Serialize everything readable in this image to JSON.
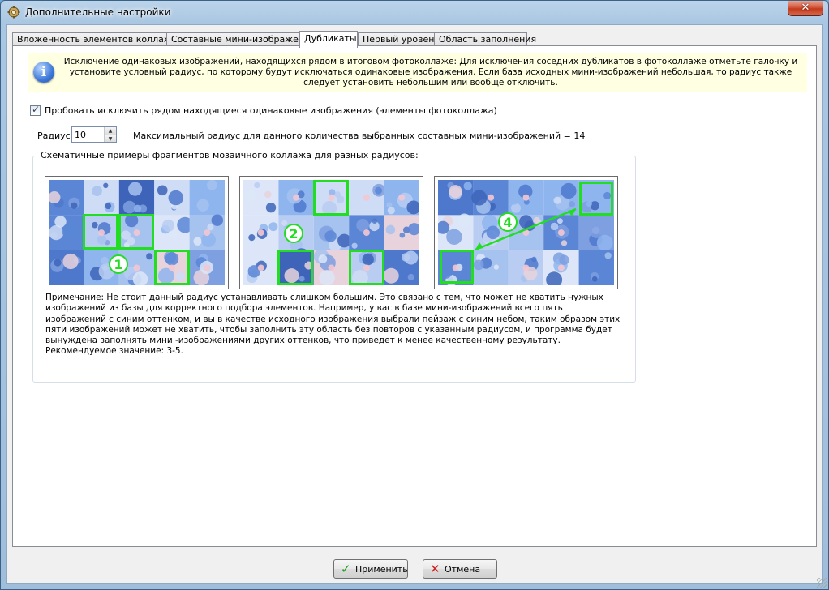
{
  "window": {
    "title": "Дополнительные настройки",
    "close_label": "✕"
  },
  "tabs": [
    {
      "label": "Вложенность элементов коллажа"
    },
    {
      "label": "Составные мини-изображения"
    },
    {
      "label": "Дубликаты"
    },
    {
      "label": "Первый уровень"
    },
    {
      "label": "Область заполнения"
    }
  ],
  "active_tab": "Дубликаты",
  "info": {
    "icon": "info-icon",
    "text": "Исключение одинаковых изображений, находящихся рядом в итоговом фотоколлаже: Для исключения соседних дубликатов в фотоколлаже отметьте галочку и установите условный радиус, по которому будут исключаться одинаковые изображения. Если база исходных мини-изображений небольшая, то радиус также следует установить небольшим или вообще отключить."
  },
  "exclude_duplicates": {
    "checked": true,
    "label": "Пробовать исключить рядом находящиеся одинаковые изображения (элементы фотоколлажа)"
  },
  "radius": {
    "label": "Радиус:",
    "value": "10",
    "max_text": "Максимальный радиус для данного количества выбранных составных мини-изображений = 14"
  },
  "examples_group": {
    "title": "Схематичные примеры фрагментов мозаичного коллажа для разных радиусов:",
    "examples": [
      {
        "number": "1"
      },
      {
        "number": "2"
      },
      {
        "number": "4"
      }
    ],
    "highlight_color": "#22dd22"
  },
  "note": "Примечание: Не стоит данный радиус устанавливать слишком большим. Это связано с тем, что может не хватить нужных изображений из базы для корректного подбора элементов. Например, у вас в базе мини-изображений всего пять изображений с синим оттенком, и вы в качестве исходного изображения выбрали пейзаж с синим небом, таким образом этих пяти изображений может не хватить, чтобы заполнить эту область без повторов с указанным радиусом, и программа будет вынуждена заполнять мини -изображениями других оттенков, что приведет к менее качественному результату. Рекомендуемое значение: 3-5.",
  "buttons": {
    "apply": {
      "label": "Применить",
      "icon": "check-icon",
      "color": "#1e9e1e"
    },
    "cancel": {
      "label": "Отмена",
      "icon": "cross-icon",
      "color": "#d01e1e"
    }
  }
}
